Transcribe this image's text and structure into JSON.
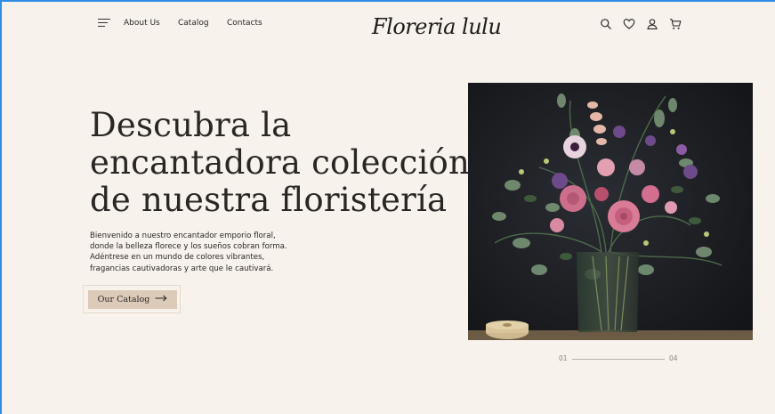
{
  "header": {
    "logo": "Floreria lulu",
    "nav": [
      "About Us",
      "Catalog",
      "Contacts"
    ]
  },
  "hero": {
    "title_lines": [
      "Descubra la",
      "encantadora colección",
      "de nuestra floristería"
    ],
    "intro_lines": [
      "Bienvenido a nuestro encantador emporio floral,",
      "donde la belleza florece y los sueños cobran forma.",
      "Adéntrese en un mundo de colores vibrantes,",
      "fragancias cautivadoras y arte que le cautivará."
    ],
    "cta_label": "Our Catalog"
  },
  "slider": {
    "current": "01",
    "total": "04"
  },
  "icons": {
    "menu": "menu-icon",
    "actions": [
      "search-icon",
      "heart-icon",
      "user-icon",
      "cart-icon"
    ],
    "cta_arrow": "arrow-right-icon"
  },
  "colors": {
    "background": "#f7f2ec",
    "cta": "#dccbb9",
    "photo_bg": "#1b1d21",
    "accent_border": "#2f8fe8"
  }
}
